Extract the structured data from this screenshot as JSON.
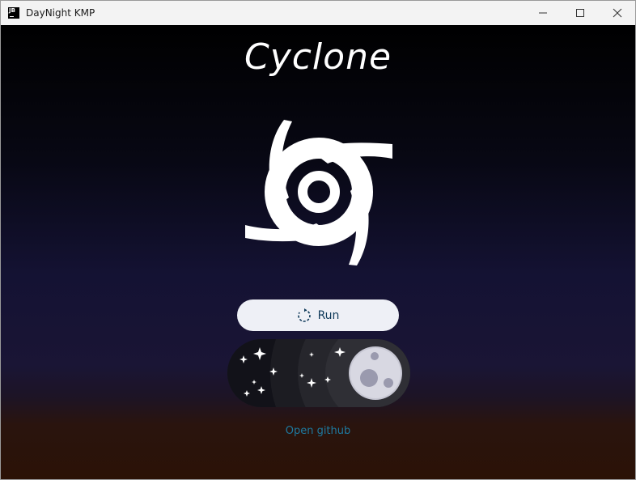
{
  "window": {
    "title": "DayNight KMP",
    "icon": "jetbrains-icon",
    "controls": [
      "minimize-icon",
      "maximize-icon",
      "close-icon"
    ]
  },
  "app": {
    "title": "Cyclone",
    "logo_icon": "cyclone-icon"
  },
  "run_button": {
    "label": "Run",
    "icon": "refresh-icon",
    "color": "#0f3a5a"
  },
  "theme_toggle": {
    "state": "night",
    "icon": "moon-icon"
  },
  "github_link": {
    "label": "Open github",
    "color": "#1e7aa0"
  }
}
